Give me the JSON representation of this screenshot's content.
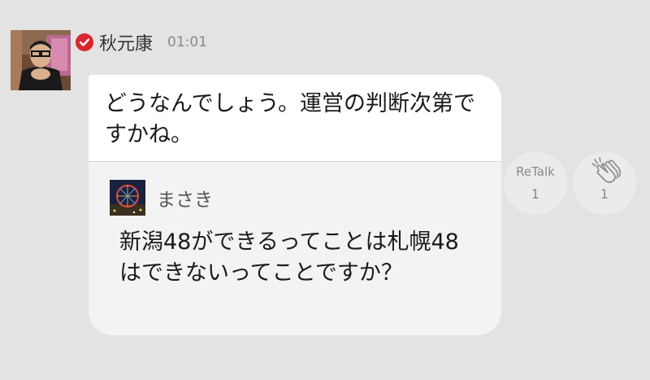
{
  "post": {
    "author": "秋元康",
    "time": "01:01",
    "text": "どうなんでしょう。運営の判断次第ですかね。"
  },
  "quote": {
    "author": "まさき",
    "text": "新潟48ができるってことは札幌48はできないってことですか？"
  },
  "actions": {
    "retalk_label": "ReTalk",
    "retalk_count": "1",
    "clap_count": "1"
  },
  "colors": {
    "background": "#e3e3e3",
    "bubble": "#ffffff",
    "quote_background": "#f3f3f3",
    "verified_badge": "#d8262e",
    "muted_text": "#8a8a8a"
  },
  "icons": {
    "verified": "check-circle-icon",
    "clap": "clapping-hands-icon"
  }
}
